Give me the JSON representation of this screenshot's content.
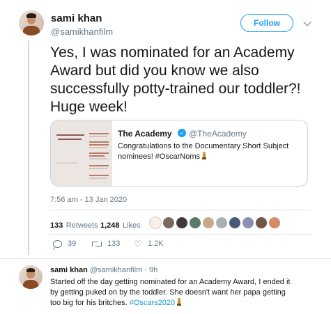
{
  "tweet": {
    "author_name": "sami khan",
    "author_handle": "@samikhanfilm",
    "follow_label": "Follow",
    "text": "Yes, I was nominated for an Academy Award but did you know we also successfully potty-trained our toddler?! Huge week!",
    "timestamp": "7:56 am - 13 Jan 2020",
    "retweets_count": "133",
    "retweets_label": "Retweets",
    "likes_count": "1,248",
    "likes_label": "Likes",
    "actions": {
      "reply_count": "39",
      "retweet_count": "133",
      "like_count": "1.2K"
    }
  },
  "quoted_tweet": {
    "author_name": "The Academy",
    "author_handle": "@TheAcademy",
    "text": "Congratulations to the Documentary Short Subject nominees! #OscarNoms",
    "image_text": {
      "title": "DOCUMENTARY SHORT SUBJECT",
      "list": [
        "IN THE ABSENCE",
        "LEARNING TO SKATEBOARD IN A WARZONE (IF YOU'RE A GIRL)",
        "LIFE OVERTAKES ME",
        "ST. LOUIS SUPERMAN",
        "WALK RUN CHA-CHA"
      ]
    }
  },
  "reply_tweet": {
    "author_name": "sami khan",
    "author_handle": "@samikhanfilm",
    "time": "· 9h",
    "text": "Started off the day getting nominated for an Academy Award, I ended it by getting puked on by the toddler. She doesn't want her papa getting too big for his britches.",
    "hashtag": "#Oscars2020"
  },
  "colors": {
    "accent": "#1da1f2",
    "hashtag": "#1b95e0",
    "secondary_text": "#657786",
    "border": "#ccd6dd"
  },
  "icons": {
    "reply": "reply-icon",
    "retweet": "retweet-icon",
    "like": "heart-icon",
    "verified": "verified-icon",
    "more": "chevron-down-icon",
    "trophy": "trophy-icon"
  }
}
